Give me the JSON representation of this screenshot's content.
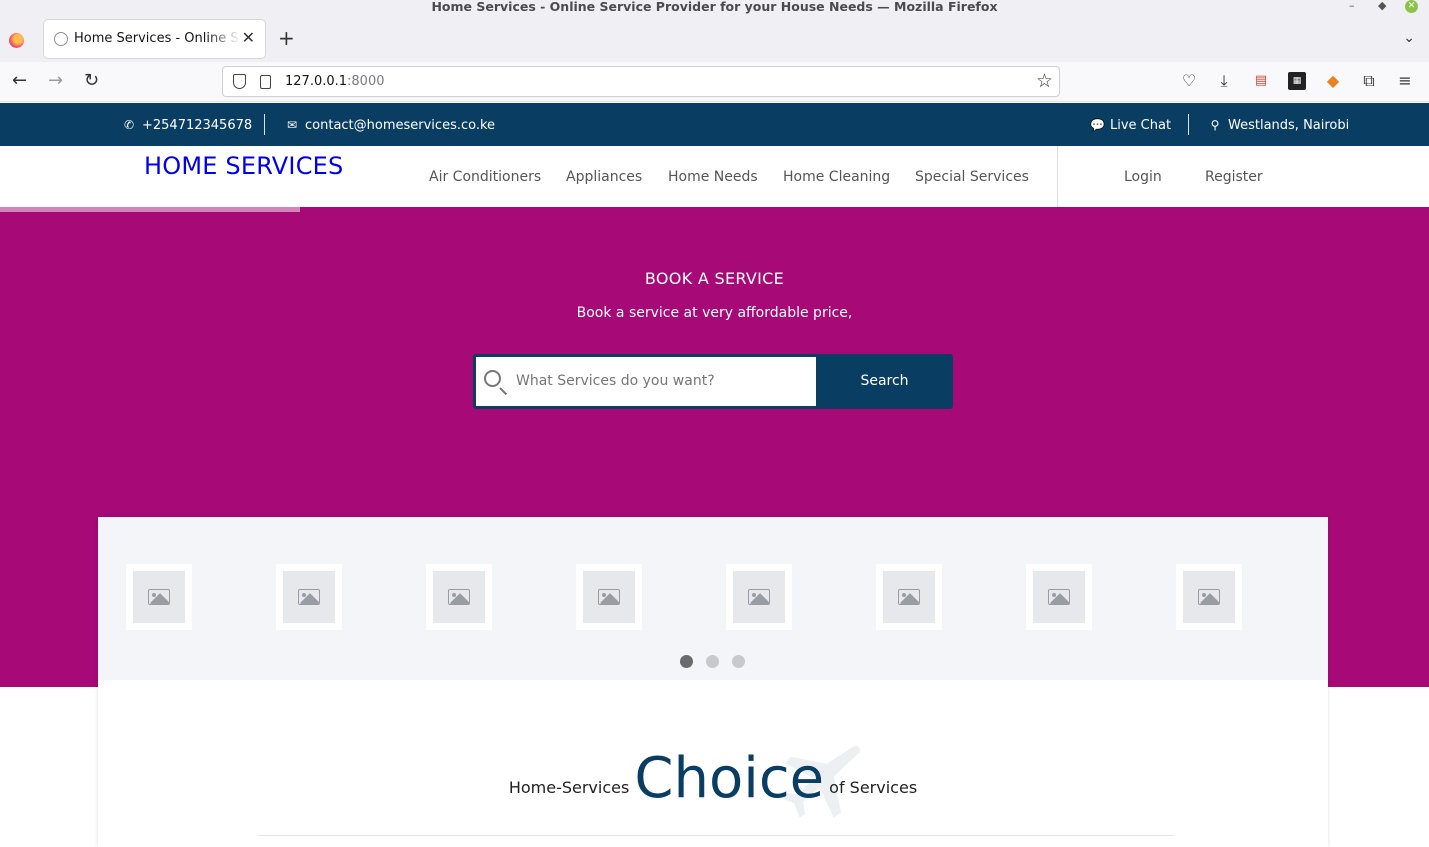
{
  "browser": {
    "window_title": "Home Services - Online Service Provider for your House Needs — Mozilla Firefox",
    "tab_title": "Home Services - Online Service Provider for your House Needs",
    "url_host": "127.0.0.1",
    "url_port": ":8000"
  },
  "topbar": {
    "phone": "+254712345678",
    "email": "contact@homeservices.co.ke",
    "live_chat": "Live Chat",
    "location": "Westlands, Nairobi"
  },
  "header": {
    "brand": "HOME SERVICES",
    "nav": {
      "air_conditioners": "Air Conditioners",
      "appliances": "Appliances",
      "home_needs": "Home Needs",
      "home_cleaning": "Home Cleaning",
      "special_services": "Special Services"
    },
    "login": "Login",
    "register": "Register"
  },
  "hero": {
    "title": "BOOK A SERVICE",
    "subtitle": "Book a service at very affordable price,",
    "search_placeholder": "What Services do you want?",
    "search_button": "Search"
  },
  "carousel": {
    "image_count": 8,
    "page_count": 3,
    "active_page": 1
  },
  "choice_heading": {
    "prefix": "Home-Services",
    "main": "Choice",
    "suffix": "of Services"
  },
  "colors": {
    "primary_navy": "#0a3d62",
    "hero_magenta": "#a70977",
    "brand_link_blue": "#0000ee"
  }
}
